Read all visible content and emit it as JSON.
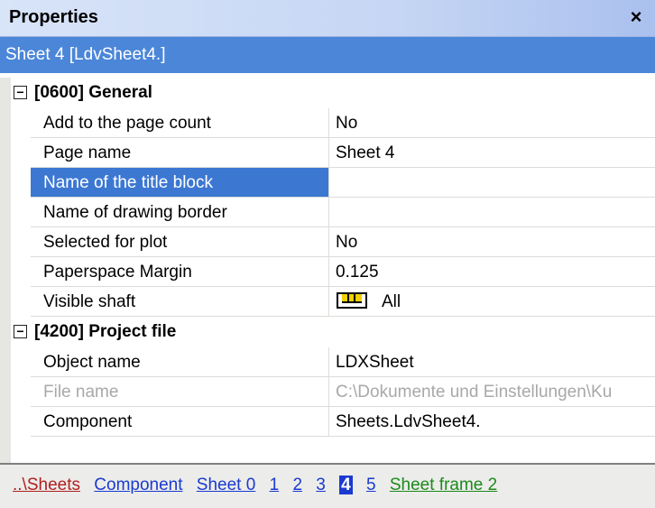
{
  "panel": {
    "title": "Properties",
    "close_glyph": "×"
  },
  "object": {
    "header": "Sheet 4 [LdvSheet4.]"
  },
  "categories": [
    {
      "label": "[0600] General",
      "toggle": "⊟",
      "rows": [
        {
          "name": "Add to the page count",
          "value": "No"
        },
        {
          "name": "Page name",
          "value": "Sheet 4"
        },
        {
          "name": "Name of the title block",
          "value": "",
          "selected": true,
          "button": "..."
        },
        {
          "name": "Name of drawing border",
          "value": ""
        },
        {
          "name": "Selected for plot",
          "value": "No"
        },
        {
          "name": "Paperspace Margin",
          "value": "0.125"
        },
        {
          "name": "Visible shaft",
          "value": "All",
          "icon": "shaft-icon"
        }
      ]
    },
    {
      "label": "[4200] Project file",
      "toggle": "⊟",
      "rows": [
        {
          "name": "Object name",
          "value": "LDXSheet"
        },
        {
          "name": "File name",
          "value": "C:\\Dokumente und Einstellungen\\Ku",
          "disabled": true
        },
        {
          "name": "Component",
          "value": "Sheets.LdvSheet4."
        }
      ]
    }
  ],
  "breadcrumb": {
    "items": [
      "..\\Sheets",
      "Component",
      "Sheet 0",
      "1",
      "2",
      "3",
      "4",
      "5",
      "Sheet frame 2"
    ],
    "current": "4"
  },
  "colors": {
    "accent": "#3c78d2",
    "header_bar": "#4b86d8",
    "link_blue": "#1a3ad0",
    "link_red": "#b02020",
    "link_green": "#1c8a1c"
  }
}
